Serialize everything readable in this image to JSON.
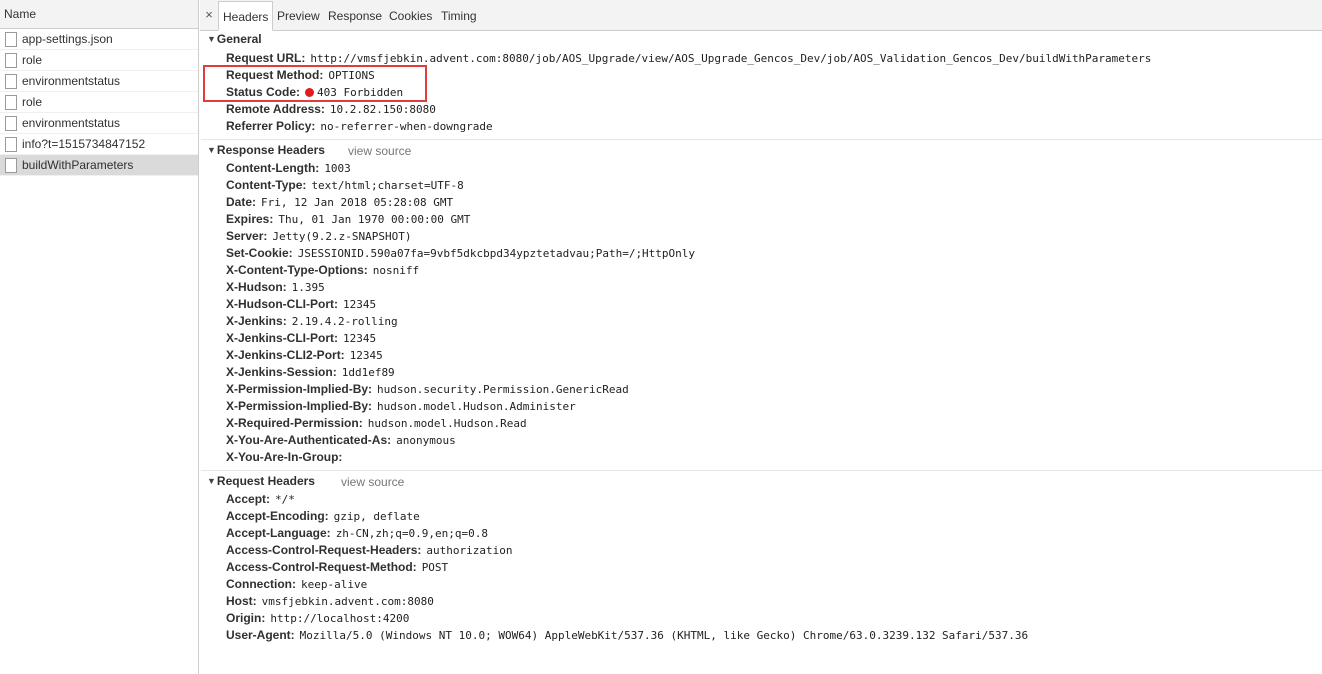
{
  "request_list": {
    "header": "Name",
    "items": [
      {
        "name": "app-settings.json",
        "selected": false
      },
      {
        "name": "role",
        "selected": false
      },
      {
        "name": "environmentstatus",
        "selected": false
      },
      {
        "name": "role",
        "selected": false
      },
      {
        "name": "environmentstatus",
        "selected": false
      },
      {
        "name": "info?t=1515734847152",
        "selected": false
      },
      {
        "name": "buildWithParameters",
        "selected": true
      }
    ]
  },
  "tabs": {
    "close": "×",
    "items": [
      "Headers",
      "Preview",
      "Response",
      "Cookies",
      "Timing"
    ],
    "active": "Headers"
  },
  "general": {
    "title": "General",
    "rows": [
      {
        "key": "Request URL:",
        "value": "http://vmsfjebkin.advent.com:8080/job/AOS_Upgrade/view/AOS_Upgrade_Gencos_Dev/job/AOS_Validation_Gencos_Dev/buildWithParameters"
      },
      {
        "key": "Request Method:",
        "value": "OPTIONS"
      },
      {
        "key": "Status Code:",
        "value": "403 Forbidden"
      },
      {
        "key": "Remote Address:",
        "value": "10.2.82.150:8080"
      },
      {
        "key": "Referrer Policy:",
        "value": "no-referrer-when-downgrade"
      }
    ]
  },
  "response_headers": {
    "title": "Response Headers",
    "view_source": "view source",
    "rows": [
      {
        "key": "Content-Length:",
        "value": "1003"
      },
      {
        "key": "Content-Type:",
        "value": "text/html;charset=UTF-8"
      },
      {
        "key": "Date:",
        "value": "Fri, 12 Jan 2018 05:28:08 GMT"
      },
      {
        "key": "Expires:",
        "value": "Thu, 01 Jan 1970 00:00:00 GMT"
      },
      {
        "key": "Server:",
        "value": "Jetty(9.2.z-SNAPSHOT)"
      },
      {
        "key": "Set-Cookie:",
        "value": "JSESSIONID.590a07fa=9vbf5dkcbpd34ypztetadvau;Path=/;HttpOnly"
      },
      {
        "key": "X-Content-Type-Options:",
        "value": "nosniff"
      },
      {
        "key": "X-Hudson:",
        "value": "1.395"
      },
      {
        "key": "X-Hudson-CLI-Port:",
        "value": "12345"
      },
      {
        "key": "X-Jenkins:",
        "value": "2.19.4.2-rolling"
      },
      {
        "key": "X-Jenkins-CLI-Port:",
        "value": "12345"
      },
      {
        "key": "X-Jenkins-CLI2-Port:",
        "value": "12345"
      },
      {
        "key": "X-Jenkins-Session:",
        "value": "1dd1ef89"
      },
      {
        "key": "X-Permission-Implied-By:",
        "value": "hudson.security.Permission.GenericRead"
      },
      {
        "key": "X-Permission-Implied-By:",
        "value": "hudson.model.Hudson.Administer"
      },
      {
        "key": "X-Required-Permission:",
        "value": "hudson.model.Hudson.Read"
      },
      {
        "key": "X-You-Are-Authenticated-As:",
        "value": "anonymous"
      },
      {
        "key": "X-You-Are-In-Group:",
        "value": ""
      }
    ]
  },
  "request_headers": {
    "title": "Request Headers",
    "view_source": "view source",
    "rows": [
      {
        "key": "Accept:",
        "value": "*/*"
      },
      {
        "key": "Accept-Encoding:",
        "value": "gzip, deflate"
      },
      {
        "key": "Accept-Language:",
        "value": "zh-CN,zh;q=0.9,en;q=0.8"
      },
      {
        "key": "Access-Control-Request-Headers:",
        "value": "authorization"
      },
      {
        "key": "Access-Control-Request-Method:",
        "value": "POST"
      },
      {
        "key": "Connection:",
        "value": "keep-alive"
      },
      {
        "key": "Host:",
        "value": "vmsfjebkin.advent.com:8080"
      },
      {
        "key": "Origin:",
        "value": "http://localhost:4200"
      },
      {
        "key": "User-Agent:",
        "value": "Mozilla/5.0 (Windows NT 10.0; WOW64) AppleWebKit/537.36 (KHTML, like Gecko) Chrome/63.0.3239.132 Safari/537.36"
      }
    ]
  },
  "colors": {
    "status_error": "#e21c1c",
    "highlight_box": "#e23b3b",
    "selected_row": "#dadada"
  }
}
